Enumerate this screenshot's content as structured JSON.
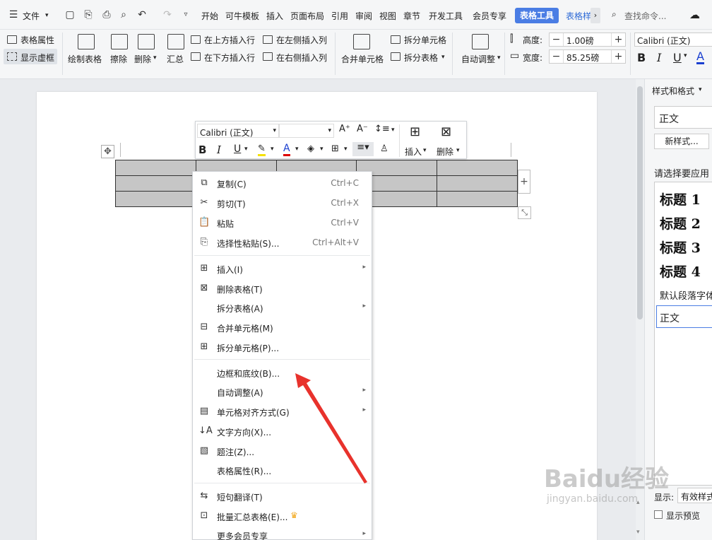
{
  "menubar": {
    "file": "文件",
    "tabs": [
      "开始",
      "可牛模板",
      "插入",
      "页面布局",
      "引用",
      "审阅",
      "视图",
      "章节",
      "开发工具",
      "会员专享"
    ],
    "active_tab": "表格工具",
    "next_tab": "表格样",
    "search": "查找命令..."
  },
  "ribbon": {
    "table_props": "表格属性",
    "show_grid": "显示虚框",
    "draw_table": "绘制表格",
    "erase": "擦除",
    "delete": "删除",
    "summary": "汇总",
    "insert_above": "在上方插入行",
    "insert_below": "在下方插入行",
    "insert_left": "在左侧插入列",
    "insert_right": "在右侧插入列",
    "merge_cells": "合并单元格",
    "split_cells": "拆分单元格",
    "split_table": "拆分表格",
    "auto_fit": "自动调整",
    "height_label": "高度:",
    "height_value": "1.00磅",
    "width_label": "宽度:",
    "width_value": "85.25磅",
    "font": "Calibri (正文)",
    "bold": "B",
    "italic": "I",
    "underline": "U",
    "font_color": "A"
  },
  "mini_toolbar": {
    "font": "Calibri (正文)",
    "insert": "插入",
    "delete": "删除"
  },
  "context_menu": {
    "items": [
      {
        "label": "复制(C)",
        "shortcut": "Ctrl+C",
        "submenu": false
      },
      {
        "label": "剪切(T)",
        "shortcut": "Ctrl+X",
        "submenu": false
      },
      {
        "label": "粘贴",
        "shortcut": "Ctrl+V",
        "submenu": false
      },
      {
        "label": "选择性粘贴(S)...",
        "shortcut": "Ctrl+Alt+V",
        "submenu": false
      },
      {
        "label": "插入(I)",
        "shortcut": "",
        "submenu": true
      },
      {
        "label": "删除表格(T)",
        "shortcut": "",
        "submenu": false
      },
      {
        "label": "拆分表格(A)",
        "shortcut": "",
        "submenu": true
      },
      {
        "label": "合并单元格(M)",
        "shortcut": "",
        "submenu": false
      },
      {
        "label": "拆分单元格(P)...",
        "shortcut": "",
        "submenu": false
      },
      {
        "label": "边框和底纹(B)...",
        "shortcut": "",
        "submenu": false
      },
      {
        "label": "自动调整(A)",
        "shortcut": "",
        "submenu": true
      },
      {
        "label": "单元格对齐方式(G)",
        "shortcut": "",
        "submenu": true
      },
      {
        "label": "文字方向(X)...",
        "shortcut": "",
        "submenu": false
      },
      {
        "label": "题注(Z)...",
        "shortcut": "",
        "submenu": false
      },
      {
        "label": "表格属性(R)...",
        "shortcut": "",
        "submenu": false
      },
      {
        "label": "短句翻译(T)",
        "shortcut": "",
        "submenu": false
      },
      {
        "label": "批量汇总表格(E)...",
        "shortcut": "",
        "submenu": false
      },
      {
        "label": "更多会员专享",
        "shortcut": "",
        "submenu": true
      }
    ]
  },
  "right_panel": {
    "title": "样式和格式",
    "current_style": "正文",
    "new_style": "新样式...",
    "apply_label": "请选择要应用",
    "styles": [
      "标题 1",
      "标题 2",
      "标题 3",
      "标题 4"
    ],
    "default_font": "默认段落字体",
    "normal": "正文",
    "show_label": "显示:",
    "show_value": "有效样式",
    "preview": "显示预览"
  },
  "watermark": {
    "brand": "Baidu经验",
    "url": "jingyan.baidu.com"
  },
  "colors": {
    "accent": "#4a7de4",
    "table_fill": "#c6c6c6",
    "arrow": "#e8322c"
  }
}
